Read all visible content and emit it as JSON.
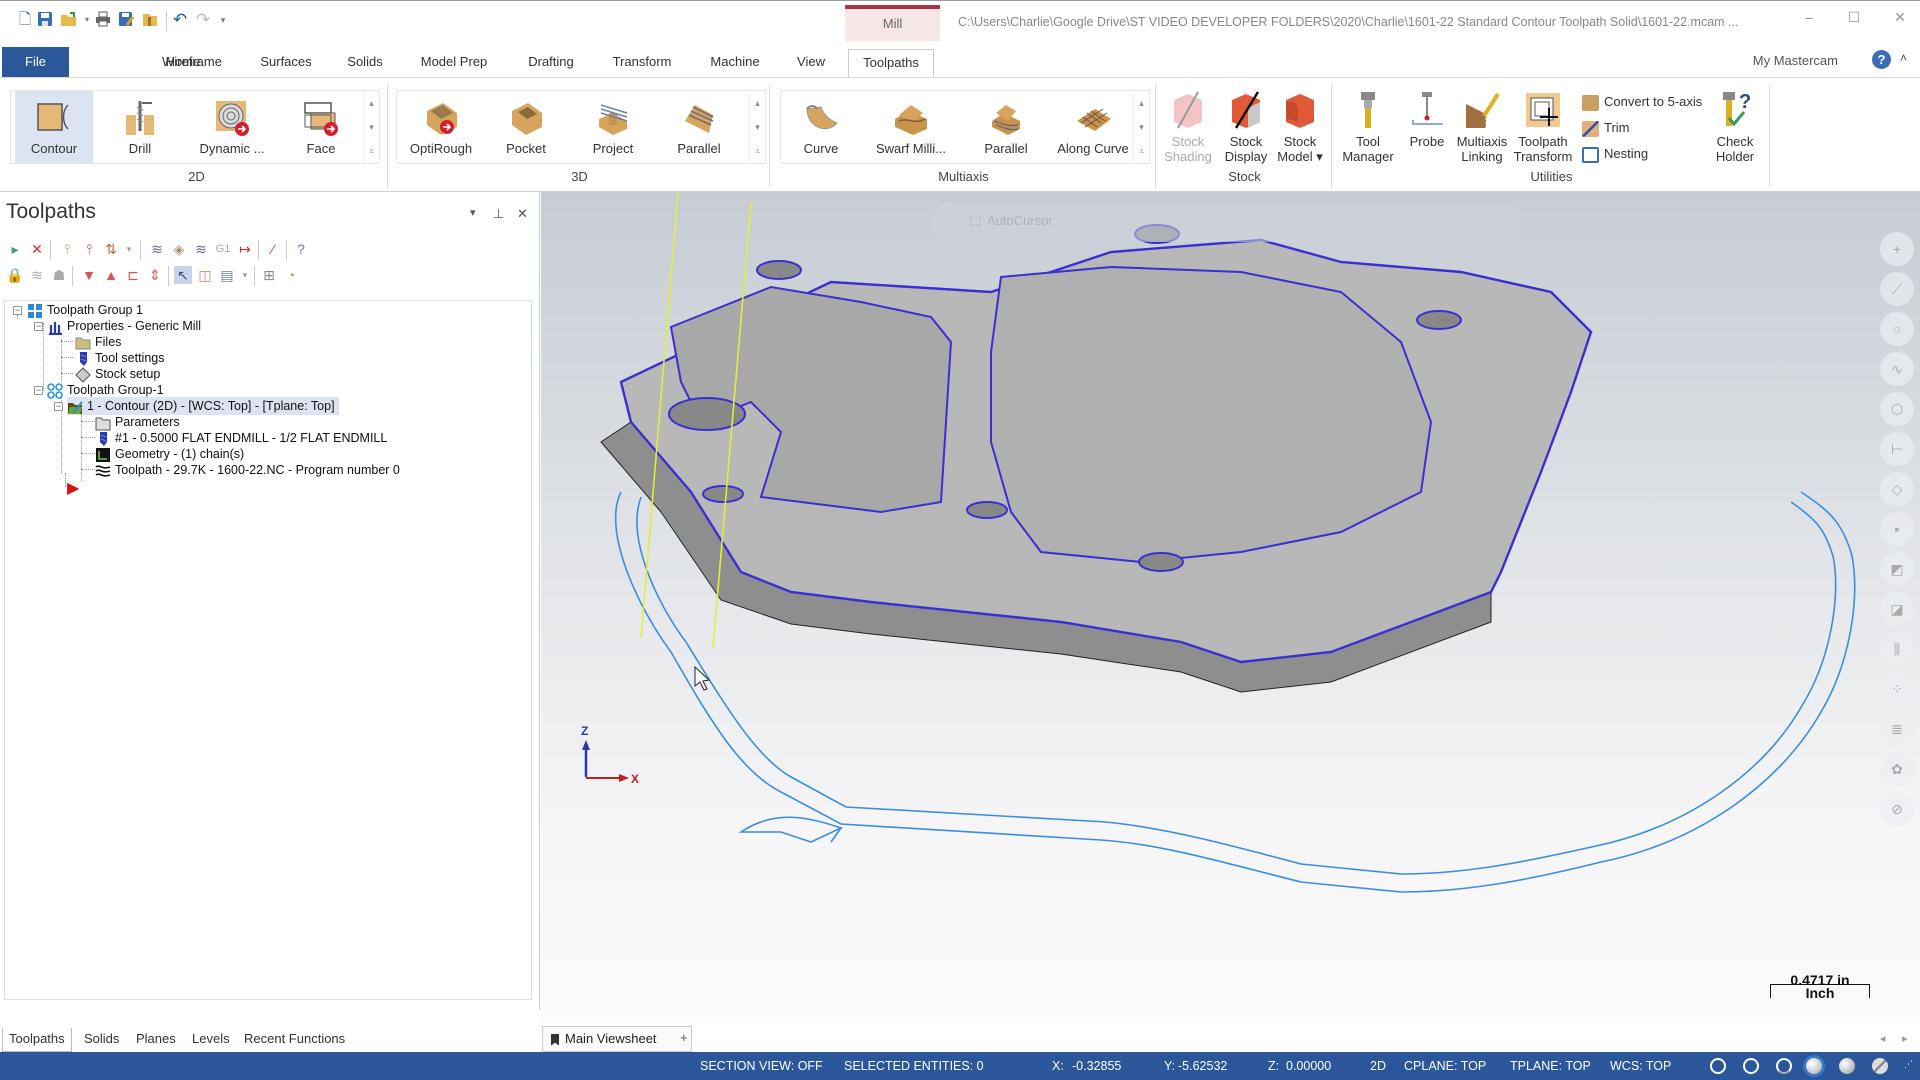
{
  "quick_access": {
    "icons": [
      "new-file-icon",
      "save-icon",
      "open-icon",
      "print-icon",
      "save-as-icon",
      "file-props-icon",
      "undo-icon",
      "redo-icon",
      "customize-icon"
    ]
  },
  "title_bar": {
    "context_tab": "Mill",
    "file_path": "C:\\Users\\Charlie\\Google Drive\\ST VIDEO DEVELOPER FOLDERS\\2020\\Charlie\\1601-22 Standard Contour Toolpath Solid\\1601-22.mcam ...",
    "minimize": "–",
    "maximize": "☐",
    "close": "✕"
  },
  "ribbon_tabs": {
    "file": "File",
    "items": [
      "Home",
      "Wireframe",
      "Surfaces",
      "Solids",
      "Model Prep",
      "Drafting",
      "Transform",
      "Machine",
      "View",
      "Toolpaths"
    ],
    "active": "Toolpaths",
    "my_mastercam": "My Mastercam",
    "help": "?",
    "collapse": "˄"
  },
  "ribbon": {
    "groups": {
      "g2d": {
        "label": "2D",
        "buttons": [
          "Contour",
          "Drill",
          "Dynamic ...",
          "Face"
        ],
        "selected": "Contour"
      },
      "g3d": {
        "label": "3D",
        "buttons": [
          "OptiRough",
          "Pocket",
          "Project",
          "Parallel"
        ]
      },
      "multiaxis": {
        "label": "Multiaxis",
        "buttons": [
          "Curve",
          "Swarf Milli...",
          "Parallel",
          "Along Curve"
        ]
      },
      "stock": {
        "label": "Stock",
        "buttons": [
          {
            "line1": "Stock",
            "line2": "Shading"
          },
          {
            "line1": "Stock",
            "line2": "Display"
          },
          {
            "line1": "Stock",
            "line2": "Model ▾"
          }
        ]
      },
      "utilities": {
        "label": "Utilities",
        "buttons": [
          {
            "line1": "Tool",
            "line2": "Manager"
          },
          {
            "line1": "Probe",
            "line2": ""
          },
          {
            "line1": "Multiaxis",
            "line2": "Linking"
          },
          {
            "line1": "Toolpath",
            "line2": "Transform"
          }
        ],
        "small_buttons": [
          "Convert to 5-axis",
          "Trim",
          "Nesting"
        ],
        "check_holder": {
          "line1": "Check",
          "line2": "Holder"
        }
      }
    },
    "scroll": {
      "up": "▴",
      "down": "▾",
      "more": "⩡"
    }
  },
  "toolpaths_panel": {
    "title": "Toolpaths",
    "controls": {
      "dropdown": "▾",
      "pin": "ᵖ",
      "close": "✕"
    },
    "tree": [
      {
        "label": "Toolpath Group 1",
        "icon": "machine-group-icon"
      },
      {
        "label": "Properties - Generic Mill",
        "icon": "properties-icon"
      },
      {
        "label": "Files",
        "icon": "folder-icon"
      },
      {
        "label": "Tool settings",
        "icon": "tool-settings-icon"
      },
      {
        "label": "Stock setup",
        "icon": "stock-setup-icon"
      },
      {
        "label": "Toolpath Group-1",
        "icon": "toolpath-group-icon"
      },
      {
        "label": "1 - Contour (2D) - [WCS: Top] - [Tplane: Top]",
        "icon": "operation-folder-icon"
      },
      {
        "label": "Parameters",
        "icon": "parameters-folder-icon"
      },
      {
        "label": "#1 - 0.5000 FLAT ENDMILL -  1/2 FLAT ENDMILL",
        "icon": "endmill-icon"
      },
      {
        "label": "Geometry - (1) chain(s)",
        "icon": "geometry-icon"
      },
      {
        "label": "Toolpath - 29.7K - 1600-22.NC - Program number 0",
        "icon": "toolpath-icon"
      }
    ],
    "insert_arrow": "▶"
  },
  "bottom_tabs": {
    "items": [
      "Toolpaths",
      "Solids",
      "Planes",
      "Levels",
      "Recent Functions"
    ],
    "active": "Toolpaths"
  },
  "viewsheet": {
    "label": "Main Viewsheet",
    "add": "+",
    "nav_prev": "◂",
    "nav_next": "▸"
  },
  "viewport": {
    "autocursor_label": "AutoCursor",
    "axis_z": "Z",
    "axis_x": "X",
    "scale_value": "0.4717 in",
    "scale_unit": "Inch"
  },
  "status_bar": {
    "section_view": "SECTION VIEW: OFF",
    "selected_entities": "SELECTED ENTITIES: 0",
    "x_label": "X:",
    "x_value": "-0.32855",
    "y_label": "Y:",
    "y_value": "-5.62532",
    "z_label": "Z:",
    "z_value": "0.00000",
    "mode": "2D",
    "cplane": "CPLANE: TOP",
    "tplane": "TPLANE: TOP",
    "wcs": "WCS: TOP"
  },
  "colors": {
    "accent_blue": "#2b579a",
    "mill_context": "#b03040",
    "toolpath_blue": "#3a8ee0",
    "chain_purple": "#3a2fd0",
    "tool_axis_yellow": "#e4ec3c"
  }
}
